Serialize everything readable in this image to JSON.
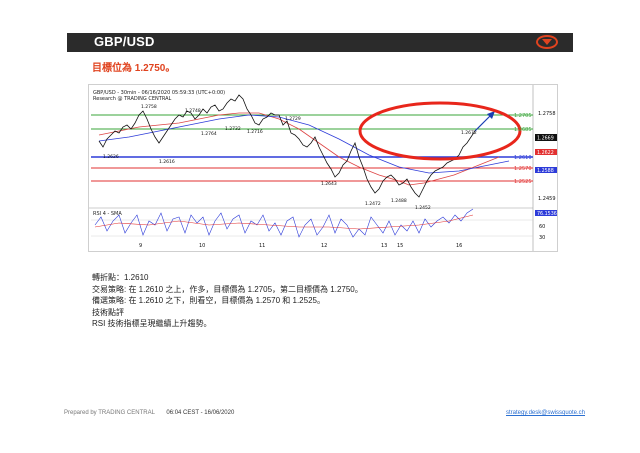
{
  "header": {
    "title": "GBP/USD",
    "dropdown_icon": "chevron-down-icon"
  },
  "subtitle": "目標位為 1.2750。",
  "chart": {
    "caption_line1": "GBP/USD - 30min - 06/16/2020 05:59:33 (UTC+0:00)",
    "caption_line2": "Research @ TRADING CENTRAL",
    "rsi_caption": "RSI 4 - SMA",
    "price_levels": [
      "1.2758",
      "1.2705",
      "1.2685",
      "1.2610",
      "1.2570",
      "1.2525",
      "1.2459"
    ],
    "right_badges": [
      "1.2669",
      "1.2622",
      "1.2588",
      "76.1536"
    ],
    "rsi_ticks": [
      "60",
      "30"
    ],
    "x_labels": [
      "9",
      "10",
      "11",
      "12",
      "13",
      "15",
      "16"
    ],
    "annotations": [
      "1.2758",
      "1.2748",
      "1.2764",
      "1.2732",
      "1.2729",
      "1.2716",
      "1.2626",
      "1.2616",
      "1.2643",
      "1.2472",
      "1.2488",
      "1.2452",
      "1.2672"
    ],
    "colors": {
      "resistance": "#3aa63a",
      "pivot": "#2d3bd9",
      "support": "#e23030",
      "ellipse": "#e8261b",
      "price": "#111111"
    }
  },
  "analysis": {
    "pivot": "轉折點：1.2610",
    "strategy": "交易策略: 在 1.2610 之上，作多，目標價為 1.2705，第二目標價為 1.2750。",
    "alternative": "備選策略: 在 1.2610 之下，則看空，目標價為 1.2570 和 1.2525。",
    "comment_title": "技術點評",
    "comment": "RSI 技術指標呈現繼續上升趨勢。"
  },
  "footer": {
    "prepared": "Prepared by TRADING CENTRAL",
    "time": "06:04 CEST - 16/06/2020",
    "email": "strategy.desk@swissquote.ch"
  }
}
